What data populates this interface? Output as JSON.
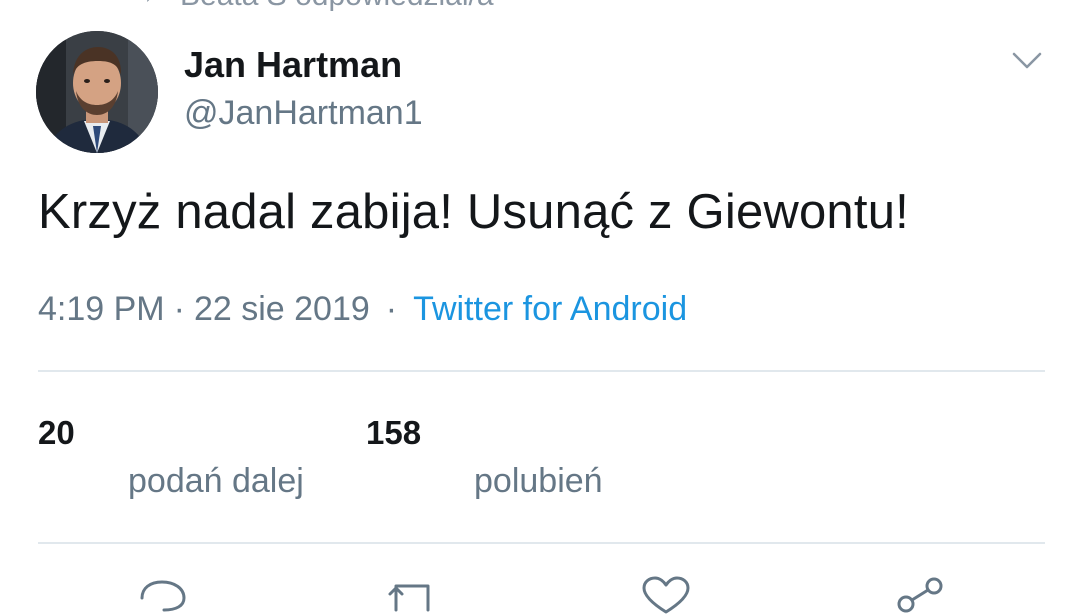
{
  "context": {
    "text": "Beata S odpowiedział/a",
    "icon": "reply-arrow-icon"
  },
  "author": {
    "display_name": "Jan Hartman",
    "handle": "@JanHartman1",
    "avatar_icon": "profile-photo"
  },
  "tweet": {
    "text": "Krzyż nadal zabija! Usunąć z Giewontu!",
    "time": "4:19 PM",
    "date": "22 sie 2019",
    "separator": "·",
    "source": "Twitter for Android"
  },
  "stats": [
    {
      "count": "20",
      "label": "podań dalej"
    },
    {
      "count": "158",
      "label": "polubień"
    }
  ],
  "actions": [
    {
      "icon": "reply-icon"
    },
    {
      "icon": "retweet-icon"
    },
    {
      "icon": "like-heart-icon"
    },
    {
      "icon": "share-icon"
    }
  ],
  "colors": {
    "text_primary": "#14171a",
    "text_secondary": "#657786",
    "link": "#1b95e0",
    "divider": "#e1e8ed"
  }
}
